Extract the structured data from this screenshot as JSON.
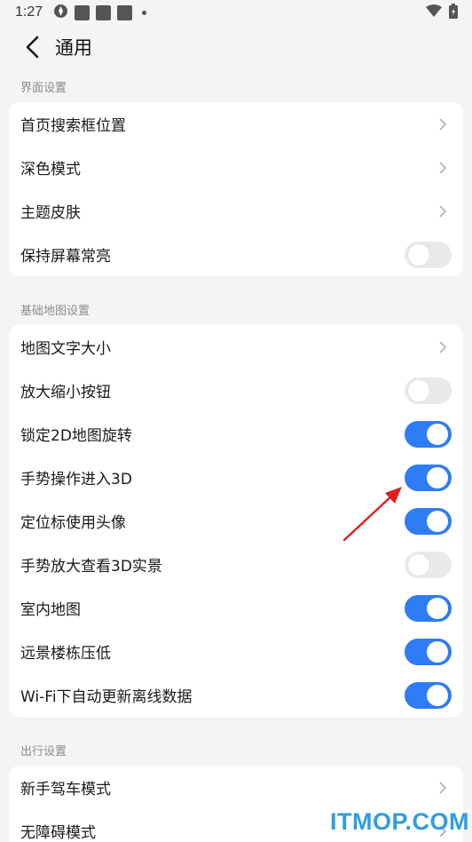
{
  "status_bar": {
    "time": "1:27"
  },
  "header": {
    "title": "通用"
  },
  "sections": [
    {
      "title": "界面设置",
      "items": [
        {
          "label": "首页搜索框位置",
          "control": "chevron"
        },
        {
          "label": "深色模式",
          "control": "chevron"
        },
        {
          "label": "主题皮肤",
          "control": "chevron"
        },
        {
          "label": "保持屏幕常亮",
          "control": "toggle",
          "on": false
        }
      ]
    },
    {
      "title": "基础地图设置",
      "items": [
        {
          "label": "地图文字大小",
          "control": "chevron"
        },
        {
          "label": "放大缩小按钮",
          "control": "toggle",
          "on": false
        },
        {
          "label": "锁定2D地图旋转",
          "control": "toggle",
          "on": true
        },
        {
          "label": "手势操作进入3D",
          "control": "toggle",
          "on": true
        },
        {
          "label": "定位标使用头像",
          "control": "toggle",
          "on": true
        },
        {
          "label": "手势放大查看3D实景",
          "control": "toggle",
          "on": false
        },
        {
          "label": "室内地图",
          "control": "toggle",
          "on": true
        },
        {
          "label": "远景楼栋压低",
          "control": "toggle",
          "on": true
        },
        {
          "label": "Wi-Fi下自动更新离线数据",
          "control": "toggle",
          "on": true
        }
      ]
    },
    {
      "title": "出行设置",
      "items": [
        {
          "label": "新手驾车模式",
          "control": "chevron"
        },
        {
          "label": "无障碍模式",
          "control": "chevron"
        }
      ]
    }
  ],
  "watermark": "ITMOP.COM",
  "colors": {
    "toggle_on": "#2e7cf6",
    "toggle_off": "#e8e9eb",
    "annotation_arrow": "#e02020",
    "watermark": "#2f9de0"
  }
}
